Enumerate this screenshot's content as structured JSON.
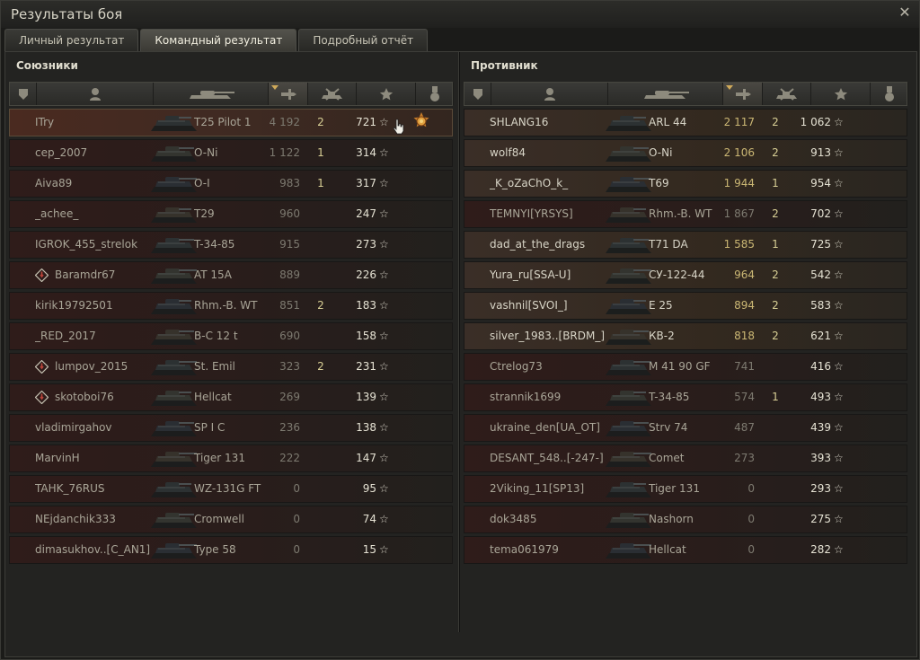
{
  "window": {
    "title": "Результаты боя",
    "close_icon": "close-icon"
  },
  "tabs": [
    {
      "label": "Личный результат",
      "active": false
    },
    {
      "label": "Командный результат",
      "active": true
    },
    {
      "label": "Подробный отчёт",
      "active": false
    }
  ],
  "columns": {
    "icons": [
      "platoon-icon",
      "player-icon",
      "tank-icon",
      "damage-icon",
      "kills-icon",
      "experience-star-icon",
      "medal-icon"
    ],
    "sorted_by": "damage"
  },
  "allies": {
    "title": "Союзники",
    "rows": [
      {
        "name": "ITry",
        "vehicle": "T25 Pilot 1",
        "damage": "4 192",
        "kills": "2",
        "xp": "721",
        "player": true,
        "medal": true,
        "alive": false
      },
      {
        "name": "сер_2007",
        "vehicle": "O-Ni",
        "damage": "1 122",
        "kills": "1",
        "xp": "314",
        "alive": false
      },
      {
        "name": "Aiva89",
        "vehicle": "O-I",
        "damage": "983",
        "kills": "1",
        "xp": "317",
        "alive": false
      },
      {
        "name": "_achee_",
        "vehicle": "T29",
        "damage": "960",
        "kills": "",
        "xp": "247",
        "alive": false
      },
      {
        "name": "IGROK_455_strelok",
        "vehicle": "T-34-85",
        "damage": "915",
        "kills": "",
        "xp": "273",
        "alive": false
      },
      {
        "name": "Baramdr67",
        "vehicle": "AT 15A",
        "damage": "889",
        "kills": "",
        "xp": "226",
        "platoon": true,
        "alive": false
      },
      {
        "name": "kirik19792501",
        "vehicle": "Rhm.-B. WT",
        "damage": "851",
        "kills": "2",
        "xp": "183",
        "alive": false
      },
      {
        "name": "_RED_2017",
        "vehicle": "B-C 12 t",
        "damage": "690",
        "kills": "",
        "xp": "158",
        "alive": false
      },
      {
        "name": "lumpov_2015",
        "vehicle": "St. Emil",
        "damage": "323",
        "kills": "2",
        "xp": "231",
        "platoon": true,
        "alive": false
      },
      {
        "name": "skotoboi76",
        "vehicle": "Hellcat",
        "damage": "269",
        "kills": "",
        "xp": "139",
        "platoon": true,
        "alive": false
      },
      {
        "name": "vladimirgahov",
        "vehicle": "SP I C",
        "damage": "236",
        "kills": "",
        "xp": "138",
        "alive": false
      },
      {
        "name": "MarvinH",
        "vehicle": "Tiger 131",
        "damage": "222",
        "kills": "",
        "xp": "147",
        "alive": false
      },
      {
        "name": "TAHK_76RUS",
        "vehicle": "WZ-131G FT",
        "damage": "0",
        "kills": "",
        "xp": "95",
        "alive": false
      },
      {
        "name": "NEjdanchik333",
        "vehicle": "Cromwell",
        "damage": "0",
        "kills": "",
        "xp": "74",
        "alive": false
      },
      {
        "name": "dimasukhov..[C_AN1]",
        "vehicle": "Type 58",
        "damage": "0",
        "kills": "",
        "xp": "15",
        "alive": false
      }
    ]
  },
  "enemies": {
    "title": "Противник",
    "rows": [
      {
        "name": "SHLANG16",
        "vehicle": "ARL 44",
        "damage": "2 117",
        "kills": "2",
        "xp": "1 062",
        "alive": true,
        "hi": true
      },
      {
        "name": "wolf84",
        "vehicle": "O-Ni",
        "damage": "2 106",
        "kills": "2",
        "xp": "913",
        "alive": true,
        "hi": true
      },
      {
        "name": "_K_oZaChO_k_",
        "vehicle": "T69",
        "damage": "1 944",
        "kills": "1",
        "xp": "954",
        "alive": true,
        "hi": true
      },
      {
        "name": "TEMNYI[YRSYS]",
        "vehicle": "Rhm.-B. WT",
        "damage": "1 867",
        "kills": "2",
        "xp": "702",
        "alive": false
      },
      {
        "name": "dad_at_the_drags",
        "vehicle": "T71 DA",
        "damage": "1 585",
        "kills": "1",
        "xp": "725",
        "alive": true,
        "hi": true
      },
      {
        "name": "Yura_ru[SSA-U]",
        "vehicle": "СУ-122-44",
        "damage": "964",
        "kills": "2",
        "xp": "542",
        "alive": true,
        "hi": true
      },
      {
        "name": "vashnil[SVOI_]",
        "vehicle": "E 25",
        "damage": "894",
        "kills": "2",
        "xp": "583",
        "alive": true,
        "hi": true
      },
      {
        "name": "silver_1983..[BRDM_]",
        "vehicle": "КВ-2",
        "damage": "818",
        "kills": "2",
        "xp": "621",
        "alive": true,
        "hi": true
      },
      {
        "name": "Ctrelog73",
        "vehicle": "M 41 90 GF",
        "damage": "741",
        "kills": "",
        "xp": "416",
        "alive": false
      },
      {
        "name": "strannik1699",
        "vehicle": "T-34-85",
        "damage": "574",
        "kills": "1",
        "xp": "493",
        "alive": false
      },
      {
        "name": "ukraine_den[UA_OT]",
        "vehicle": "Strv 74",
        "damage": "487",
        "kills": "",
        "xp": "439",
        "alive": false
      },
      {
        "name": "DESANT_548..[-247-]",
        "vehicle": "Comet",
        "damage": "273",
        "kills": "",
        "xp": "393",
        "alive": false
      },
      {
        "name": "2Viking_11[SP13]",
        "vehicle": "Tiger 131",
        "damage": "0",
        "kills": "",
        "xp": "293",
        "alive": false
      },
      {
        "name": "dok3485",
        "vehicle": "Nashorn",
        "damage": "0",
        "kills": "",
        "xp": "275",
        "alive": false
      },
      {
        "name": "tema061979",
        "vehicle": "Hellcat",
        "damage": "0",
        "kills": "",
        "xp": "282",
        "alive": false
      }
    ]
  },
  "colors": {
    "enemy_row_alive": "#3e2e25",
    "ally_row": "#2f1c1a",
    "damage_highlight": "#cbb774"
  }
}
